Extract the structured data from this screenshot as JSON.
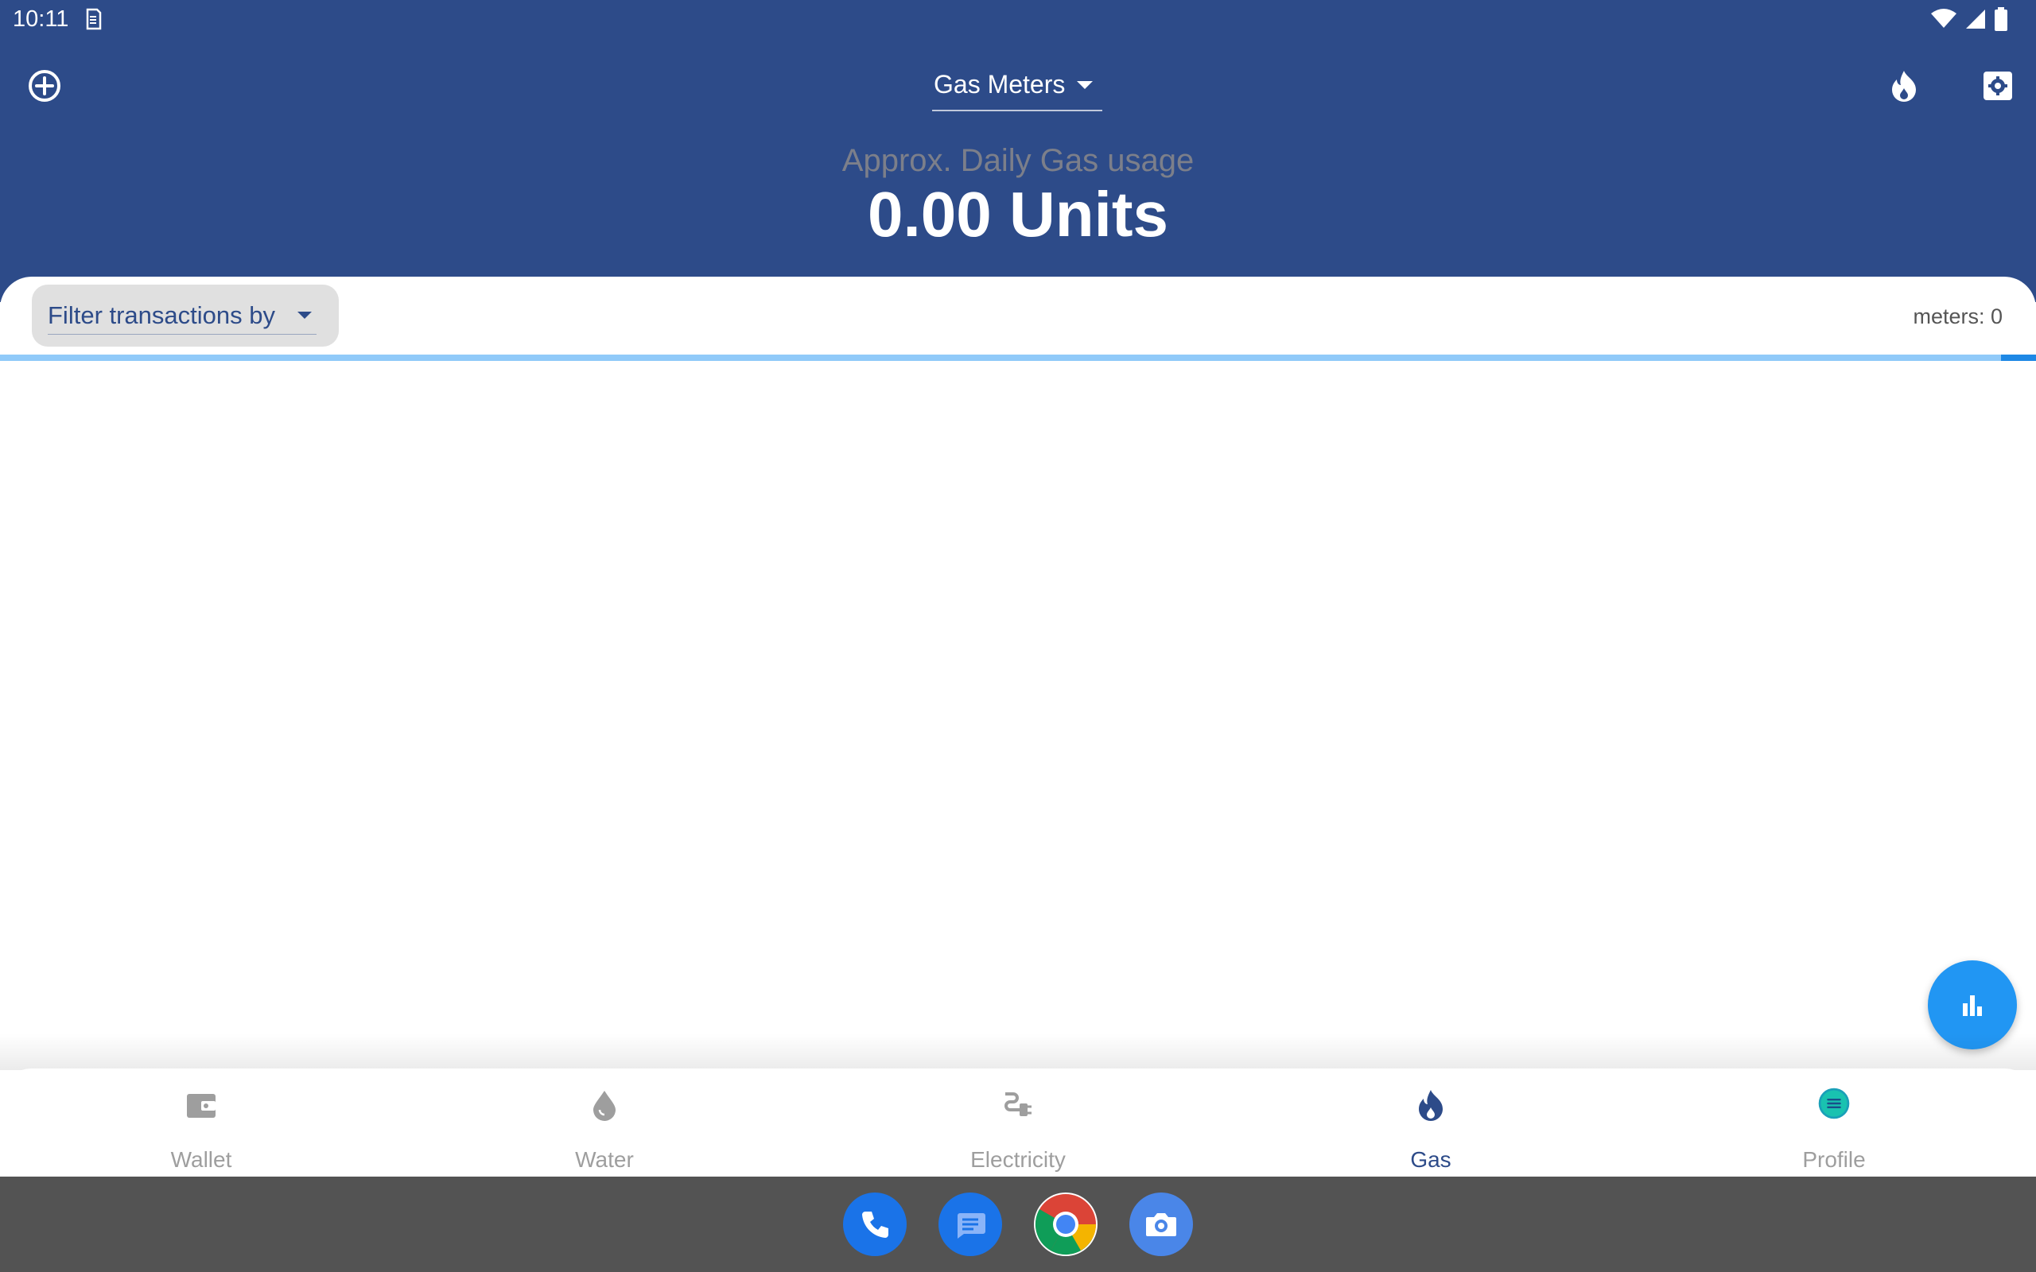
{
  "status_bar": {
    "time": "10:11"
  },
  "header": {
    "meter_type_select": "Gas Meters",
    "usage_label": "Approx. Daily Gas usage",
    "usage_value": "0.00 Units"
  },
  "filter": {
    "label": "Filter transactions by"
  },
  "meters_count": "meters: 0",
  "loading_progress": 0.017,
  "bottom_nav": {
    "items": [
      {
        "label": "Wallet",
        "icon": "wallet-icon"
      },
      {
        "label": "Water",
        "icon": "water-drop-icon"
      },
      {
        "label": "Electricity",
        "icon": "power-plug-icon"
      },
      {
        "label": "Gas",
        "icon": "flame-icon",
        "active": true
      },
      {
        "label": "Profile",
        "icon": "profile-avatar-icon"
      }
    ]
  },
  "dock": {
    "apps": [
      "phone-icon",
      "messages-icon",
      "chrome-icon",
      "camera-icon"
    ]
  },
  "colors": {
    "primary": "#2d4b89",
    "accent": "#2196f3",
    "progress_track": "#90caf9",
    "inactive_nav": "#9e9e9e",
    "dock": "#535353"
  }
}
